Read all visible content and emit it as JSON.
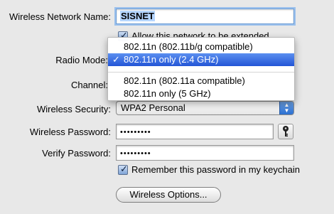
{
  "form": {
    "network_name": {
      "label": "Wireless Network Name:",
      "value": "SISNET"
    },
    "extend_checkbox": {
      "label": "Allow this network to be extended",
      "checked": true
    },
    "radio_mode": {
      "label": "Radio Mode:",
      "menu": {
        "options": [
          "802.11n (802.11b/g compatible)",
          "802.11n only (2.4 GHz)",
          "802.11n (802.11a compatible)",
          "802.11n only (5 GHz)"
        ],
        "selected": "802.11n only (2.4 GHz)"
      }
    },
    "channel": {
      "label": "Channel:"
    },
    "security": {
      "label": "Wireless Security:",
      "value": "WPA2 Personal"
    },
    "password": {
      "label": "Wireless Password:",
      "value": "•••••••••"
    },
    "verify_password": {
      "label": "Verify Password:",
      "value": "•••••••••"
    },
    "remember_checkbox": {
      "label": "Remember this password in my keychain",
      "checked": true
    },
    "options_button": {
      "label": "Wireless Options..."
    }
  },
  "icons": {
    "key": "keychain-key-icon",
    "check": "checkmark-icon",
    "popup_arrows": "popup-arrows-icon"
  },
  "colors": {
    "background": "#e8e8e8",
    "selection": "#2355d6",
    "focus_ring": "#9cc1ec"
  }
}
